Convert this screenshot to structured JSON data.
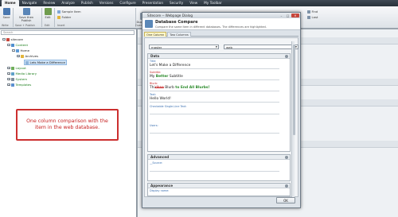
{
  "menubar": {
    "items": [
      "Home",
      "Navigate",
      "Review",
      "Analyze",
      "Publish",
      "Versions",
      "Configure",
      "Presentation",
      "Security",
      "View",
      "My Toolbar"
    ],
    "active_index": 0
  },
  "ribbon": {
    "save_label": "Save",
    "save_group": "Write",
    "save_close_label": "Save then Publish",
    "save_close_group": "Save + Publish",
    "edit_label": "Edit",
    "edit_group": "Edit",
    "insert_items": [
      "Sample Item",
      "Folder"
    ],
    "insert_group": "Insert",
    "duplicate_label": "Duplicate",
    "operations_group": "Operations",
    "find_label": "Find",
    "last_label": "Last"
  },
  "tree": {
    "search_placeholder": "Search",
    "nodes": [
      {
        "label": "sitecore",
        "level": 0,
        "icon": "sitecore-icon"
      },
      {
        "label": "Content",
        "level": 1,
        "icon": "content-icon"
      },
      {
        "label": "Home",
        "level": 2,
        "icon": "home-icon"
      },
      {
        "label": "Archives",
        "level": 3,
        "icon": "folder-icon"
      },
      {
        "label": "Lets Make a Difference",
        "level": 3,
        "icon": "page-icon",
        "selected": true
      },
      {
        "label": "Layout",
        "level": 1,
        "icon": "layout-icon"
      },
      {
        "label": "Media Library",
        "level": 1,
        "icon": "media-icon"
      },
      {
        "label": "System",
        "level": 1,
        "icon": "system-icon"
      },
      {
        "label": "Templates",
        "level": 1,
        "icon": "templates-icon"
      }
    ]
  },
  "callout": {
    "text": "One column comparison with the item in the web database."
  },
  "dialog": {
    "title": "Sitecore -- Webpage Dialog",
    "header_title": "Database Compare",
    "header_subtitle": "Compare the same item in different databases. The differences are highlighted.",
    "tabs": [
      "One Column",
      "Two Columns"
    ],
    "active_tab": 0,
    "left_db": "master",
    "right_db": "web",
    "sections": [
      {
        "title": "Data",
        "fields": [
          {
            "label": "Title:",
            "value": "Let's Make a Difference"
          },
          {
            "label": "Subtitle:",
            "value_parts": [
              "My ",
              "Better",
              " Subtitle"
            ]
          },
          {
            "label": "Blurb:",
            "value_parts": [
              "Thi",
              "ckso",
              " Blurb ",
              "to End All Blurbs!"
            ]
          },
          {
            "label": "Text:",
            "value": "Hello World!"
          },
          {
            "label": "Checkable Single-Line Text:",
            "value": ""
          },
          {
            "label": "Users:",
            "value": ""
          }
        ]
      },
      {
        "title": "Advanced",
        "fields": [
          {
            "label": "__Source:",
            "value": ""
          }
        ]
      },
      {
        "title": "Appearance",
        "fields": [
          {
            "label": "Display name:",
            "value": ""
          }
        ]
      }
    ],
    "ok_label": "OK"
  },
  "colors": {
    "callout_border": "#cc2f2f",
    "callout_text": "#c62020",
    "added_text": "#2a8a2a",
    "removed_text": "#c62828",
    "field_label": "#3a6fb0",
    "tree_green": "#1a7d1a"
  }
}
